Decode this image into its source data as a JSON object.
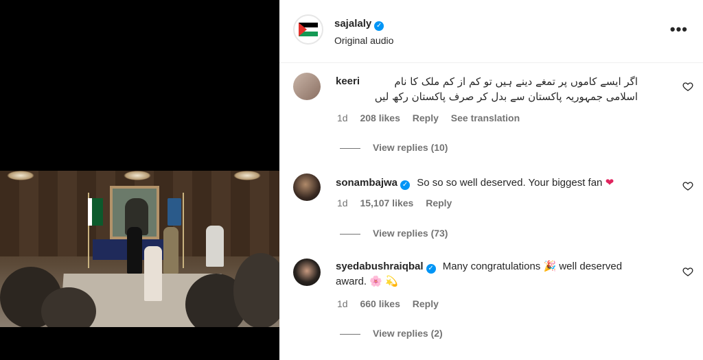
{
  "post": {
    "author": "sajalaly",
    "subtitle": "Original audio",
    "more_label": "•••"
  },
  "comments": [
    {
      "username": "keeri",
      "verified": false,
      "text_line1": "اگر ایسے کاموں پر تمغے دینے ہیں تو کم از کم ملک کا نام",
      "text_line2": "اسلامی جمہوریہ پاکستان سے بدل کر صرف پاکستان رکھ لیں",
      "age": "1d",
      "likes": "208 likes",
      "reply": "Reply",
      "translate": "See translation",
      "view_replies": "View replies (10)"
    },
    {
      "username": "sonambajwa",
      "verified": true,
      "text": "So so so well deserved. Your biggest fan",
      "emoji": "❤",
      "age": "1d",
      "likes": "15,107 likes",
      "reply": "Reply",
      "view_replies": "View replies (73)"
    },
    {
      "username": "syedabushraiqbal",
      "verified": true,
      "text_a": "Many congratulations",
      "emoji_a": "🎉",
      "text_b": "well deserved",
      "text_c": "award.",
      "emoji_c": "🌸 💫",
      "age": "1d",
      "likes": "660 likes",
      "reply": "Reply",
      "view_replies": "View replies (2)"
    }
  ],
  "colors": {
    "verified": "#0095f6",
    "muted": "#737373",
    "text": "#262626",
    "like_heart": "#e0245e"
  }
}
